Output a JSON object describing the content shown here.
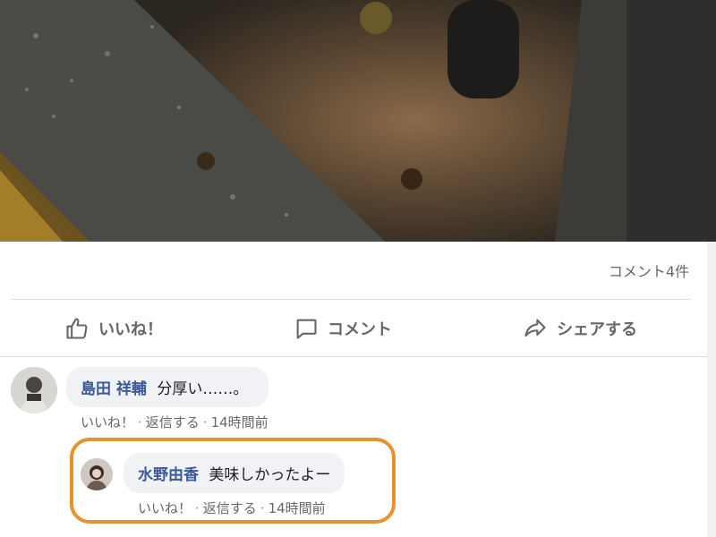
{
  "post": {
    "comment_count": "コメント4件"
  },
  "actions": {
    "like": "いいね！",
    "comment": "コメント",
    "share": "シェアする"
  },
  "comments": [
    {
      "author": "島田 祥輔",
      "text": "分厚い……。",
      "like": "いいね！",
      "reply": "返信する",
      "time": "14時間前"
    },
    {
      "author": "水野由香",
      "text": "美味しかったよー",
      "like": "いいね！",
      "reply": "返信する",
      "time": "14時間前"
    }
  ],
  "colors": {
    "author": "#3b5998",
    "highlight": "#e6922e",
    "bubble": "#f0f2f5"
  }
}
